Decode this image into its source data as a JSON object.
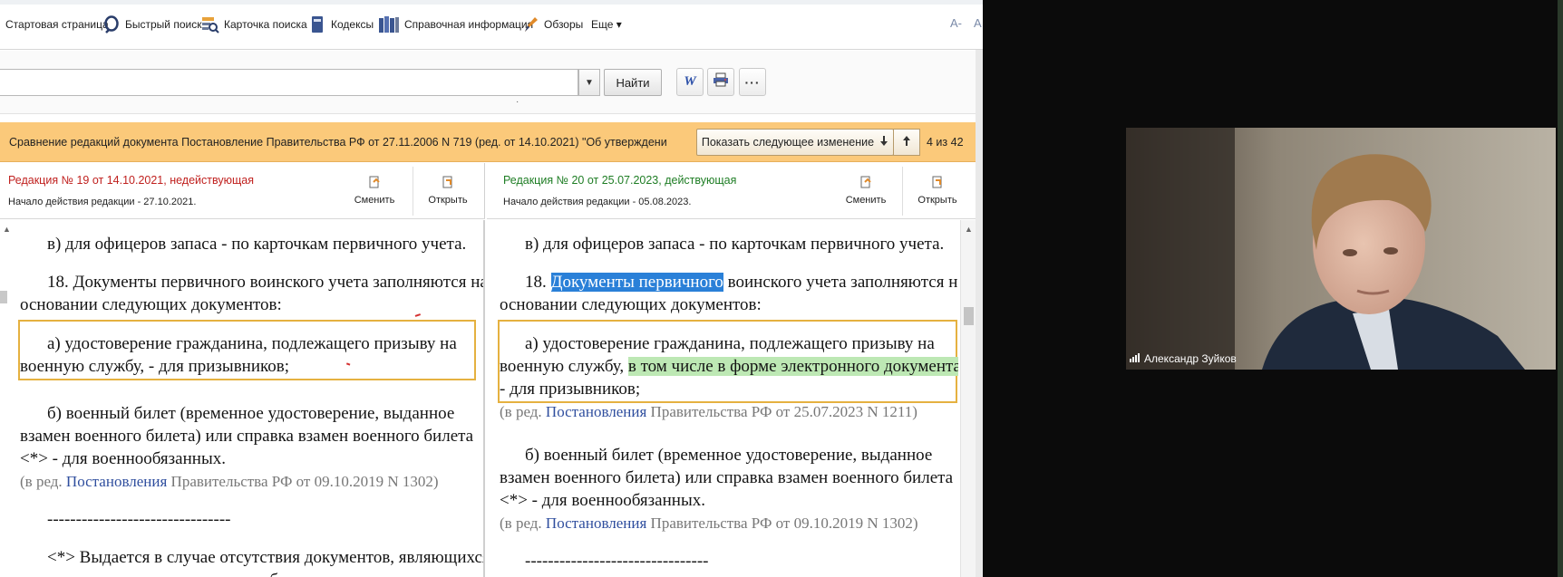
{
  "toolbar": {
    "items": [
      {
        "label": "Стартовая страница",
        "icon": "home-icon"
      },
      {
        "label": "Быстрый поиск",
        "icon": "search-icon"
      },
      {
        "label": "Карточка поиска",
        "icon": "search-card-icon"
      },
      {
        "label": "Кодексы",
        "icon": "codex-book-icon"
      },
      {
        "label": "Справочная информация",
        "icon": "reference-books-icon"
      },
      {
        "label": "Обзоры",
        "icon": "reviews-pen-icon"
      },
      {
        "label": "Еще ▾",
        "icon": ""
      }
    ],
    "font_size_small": "A-",
    "font_size_large": "A"
  },
  "search": {
    "value": "",
    "find_label": "Найти",
    "word_label": "W"
  },
  "compare": {
    "title": "Сравнение редакций документа Постановление Правительства РФ от 27.11.2006 N 719 (ред. от 14.10.2021) \"Об утверждении Положения о воинском учете\"",
    "next_change_label": "Показать следующее изменение",
    "counter": "4 из 42"
  },
  "left": {
    "title": "Редакция № 19 от 14.10.2021, недействующая",
    "subtitle": "Начало действия редакции - 27.10.2021.",
    "change_label": "Сменить",
    "open_label": "Открыть",
    "p1": "в) для офицеров запаса - по карточкам первичного учета.",
    "p2a": "18. Документы первичного воинского учета заполняются на",
    "p2b": "основании следующих документов:",
    "p3a": "а) удостоверение гражданина, подлежащего призыву на",
    "p3b": "военную службу, - для призывников;",
    "p4a": "б) военный билет (временное удостоверение, выданное",
    "p4b": "взамен военного билета) или справка взамен военного билета",
    "p4c": "<*> - для военнообязанных.",
    "ref_prefix": "(в ред. ",
    "ref_link": "Постановления",
    "ref_suffix": " Правительства РФ от 09.10.2019 N 1302)",
    "divider": "--------------------------------",
    "p5a": "<*> Выдается в случае отсутствия документов, являющихся",
    "p5b": "основанием для выдачи военного билета, или при"
  },
  "right": {
    "title": "Редакция № 20 от 25.07.2023, действующая",
    "subtitle": "Начало действия редакции - 05.08.2023.",
    "change_label": "Сменить",
    "open_label": "Открыть",
    "p1": "в) для офицеров запаса - по карточкам первичного учета.",
    "p2_num": "18. ",
    "p2_highlight": "Документы первичного",
    "p2_rest": " воинского учета заполняются на",
    "p2b": "основании следующих документов:",
    "p3a": "а) удостоверение гражданина, подлежащего призыву на",
    "p3b_plain": "военную службу, ",
    "p3b_added": "в том числе в форме электронного документа,",
    "p3c": "- для призывников;",
    "ref1_prefix": "(в ред. ",
    "ref1_link": "Постановления",
    "ref1_suffix": " Правительства РФ от 25.07.2023 N 1211)",
    "p4a": "б) военный билет (временное удостоверение, выданное",
    "p4b": "взамен военного билета) или справка взамен военного билета",
    "p4c": "<*> - для военнообязанных.",
    "ref2_prefix": "(в ред. ",
    "ref2_link": "Постановления",
    "ref2_suffix": " Правительства РФ от 09.10.2019 N 1302)",
    "divider": "--------------------------------"
  },
  "video": {
    "participant_name": "Александр Зуйков"
  },
  "colors": {
    "compare_bar": "#fbc97a",
    "old_revision": "#c0211f",
    "new_revision": "#1e7d24",
    "paragraph_frame": "#e5b140",
    "selection": "#2a80d8",
    "added_text": "#bde8b4",
    "link": "#2f4e9e"
  }
}
